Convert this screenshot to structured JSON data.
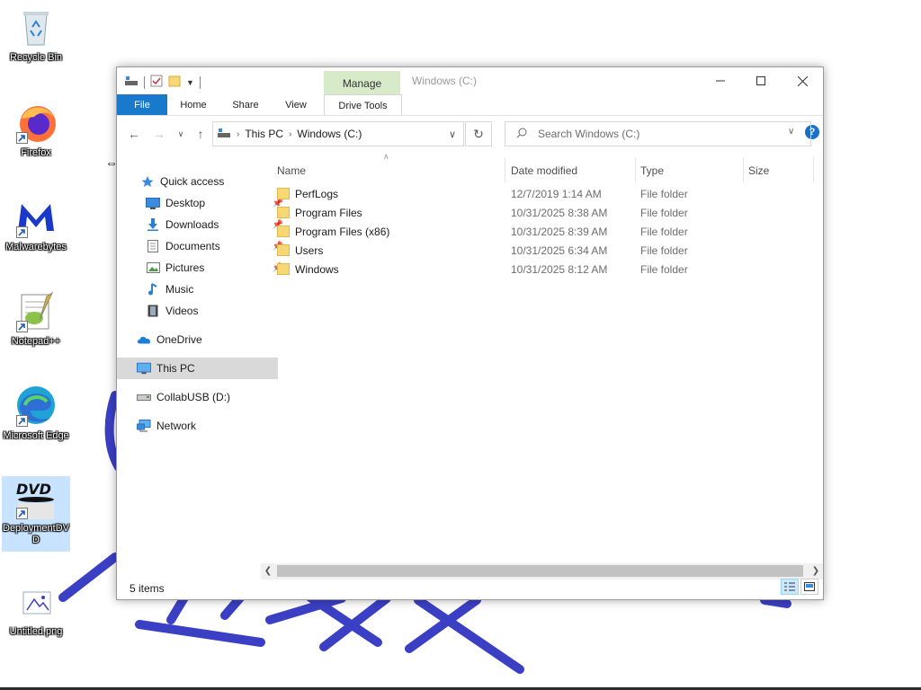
{
  "desktop": {
    "icons": [
      {
        "label": "Recycle Bin",
        "icon": "recycle-bin-icon"
      },
      {
        "label": "Firefox",
        "icon": "firefox-icon"
      },
      {
        "label": "Malwarebytes",
        "icon": "malwarebytes-icon"
      },
      {
        "label": "Notepad++",
        "icon": "notepadpp-icon"
      },
      {
        "label": "Microsoft Edge",
        "icon": "edge-icon"
      },
      {
        "label": "DeploymentDVD",
        "icon": "dvd-icon"
      },
      {
        "label": "Untitled.png",
        "icon": "image-file-icon"
      }
    ]
  },
  "window": {
    "title": "Windows (C:)",
    "context_tab_group": "Manage",
    "ribbon_tabs": [
      "File",
      "Home",
      "Share",
      "View",
      "Drive Tools"
    ],
    "address": {
      "crumbs": [
        "This PC",
        "Windows (C:)"
      ]
    },
    "search": {
      "placeholder": "Search Windows (C:)"
    },
    "nav_pane": [
      {
        "label": "Quick access",
        "icon": "star-icon"
      },
      {
        "label": "Desktop",
        "icon": "desktop-icon",
        "pinned": true
      },
      {
        "label": "Downloads",
        "icon": "download-icon",
        "pinned": true
      },
      {
        "label": "Documents",
        "icon": "document-icon",
        "pinned": true
      },
      {
        "label": "Pictures",
        "icon": "pictures-icon",
        "pinned": true
      },
      {
        "label": "Music",
        "icon": "music-icon"
      },
      {
        "label": "Videos",
        "icon": "video-icon"
      },
      {
        "label": "OneDrive",
        "icon": "cloud-icon"
      },
      {
        "label": "This PC",
        "icon": "computer-icon",
        "selected": true
      },
      {
        "label": "CollabUSB (D:)",
        "icon": "usb-drive-icon"
      },
      {
        "label": "Network",
        "icon": "network-icon"
      }
    ],
    "columns": [
      "Name",
      "Date modified",
      "Type",
      "Size"
    ],
    "files": [
      {
        "name": "PerfLogs",
        "date": "12/7/2019 1:14 AM",
        "type": "File folder"
      },
      {
        "name": "Program Files",
        "date": "10/31/2025 8:38 AM",
        "type": "File folder"
      },
      {
        "name": "Program Files (x86)",
        "date": "10/31/2025 8:39 AM",
        "type": "File folder"
      },
      {
        "name": "Users",
        "date": "10/31/2025 6:34 AM",
        "type": "File folder"
      },
      {
        "name": "Windows",
        "date": "10/31/2025 8:12 AM",
        "type": "File folder"
      }
    ],
    "status": "5 items",
    "colors": {
      "accent": "#1979ca",
      "manage_tab": "#d7ebc8",
      "folder": "#f8d775"
    }
  }
}
